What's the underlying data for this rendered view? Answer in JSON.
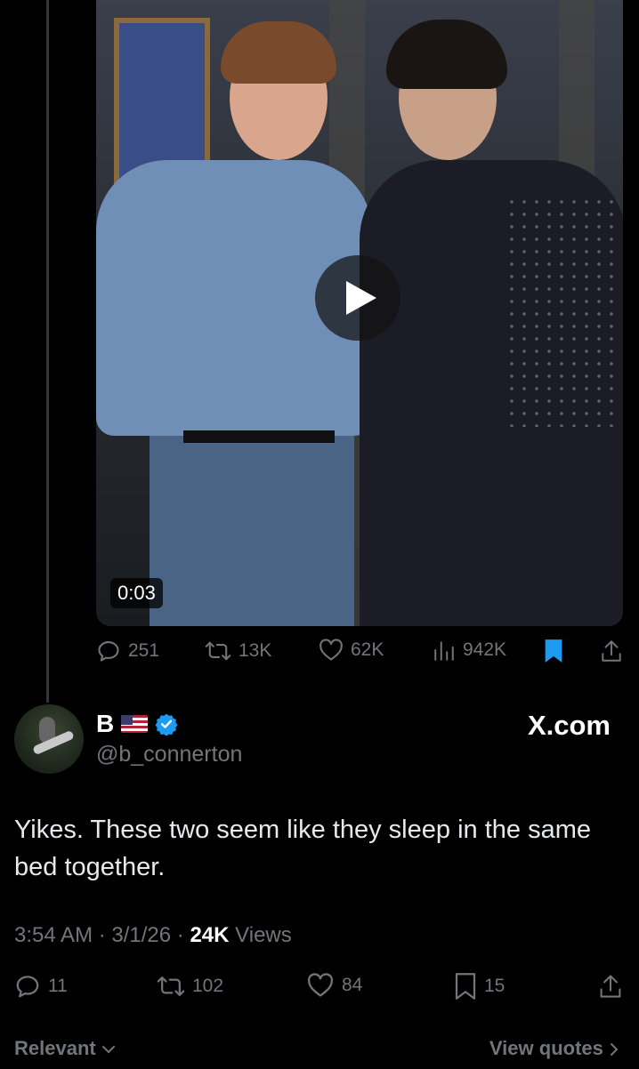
{
  "video": {
    "timestamp": "0:03"
  },
  "parent_actions": {
    "replies": "251",
    "reposts": "13K",
    "likes": "62K",
    "views": "942K"
  },
  "reply": {
    "name": "B",
    "handle": "@b_connerton",
    "site": "X.com",
    "text": "Yikes. These two seem like they sleep in the same bed together.",
    "time": "3:54 AM",
    "date": "3/1/26",
    "views_count": "24K",
    "views_label": "Views",
    "actions": {
      "replies": "11",
      "reposts": "102",
      "likes": "84",
      "bookmarks": "15"
    }
  },
  "footer": {
    "sort_label": "Relevant",
    "view_quotes_label": "View quotes"
  },
  "colors": {
    "background": "#000000",
    "muted": "#71767b",
    "accent": "#1d9bf0",
    "verified": "#1d9bf0"
  }
}
